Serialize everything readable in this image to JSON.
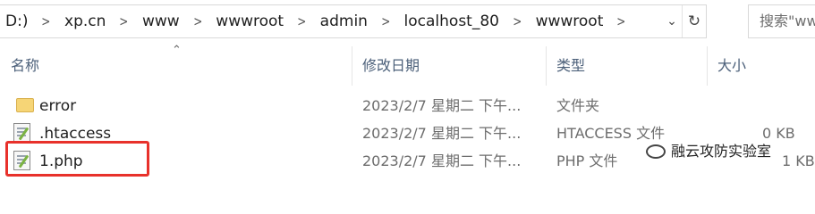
{
  "address_bar": {
    "crumbs": [
      "D:)",
      "xp.cn",
      "www",
      "wwwroot",
      "admin",
      "localhost_80",
      "wwwroot"
    ],
    "dropdown_icon": "chevron-down-icon",
    "refresh_icon": "refresh-icon"
  },
  "search": {
    "placeholder": "搜索\"ww"
  },
  "columns": {
    "name": "名称",
    "date": "修改日期",
    "type": "类型",
    "size": "大小"
  },
  "files": [
    {
      "name": "error",
      "date": "2023/2/7 星期二 下午...",
      "type": "文件夹",
      "size": "",
      "icon": "folder-icon"
    },
    {
      "name": ".htaccess",
      "date": "2023/2/7 星期二 下午...",
      "type": "HTACCESS 文件",
      "size": "0 KB",
      "icon": "php-file-icon"
    },
    {
      "name": "1.php",
      "date": "2023/2/7 星期二 下午...",
      "type": "PHP 文件",
      "size": "1 KB",
      "icon": "php-file-icon"
    }
  ],
  "watermark": "融云攻防实验室",
  "highlight_color": "#e8312b"
}
